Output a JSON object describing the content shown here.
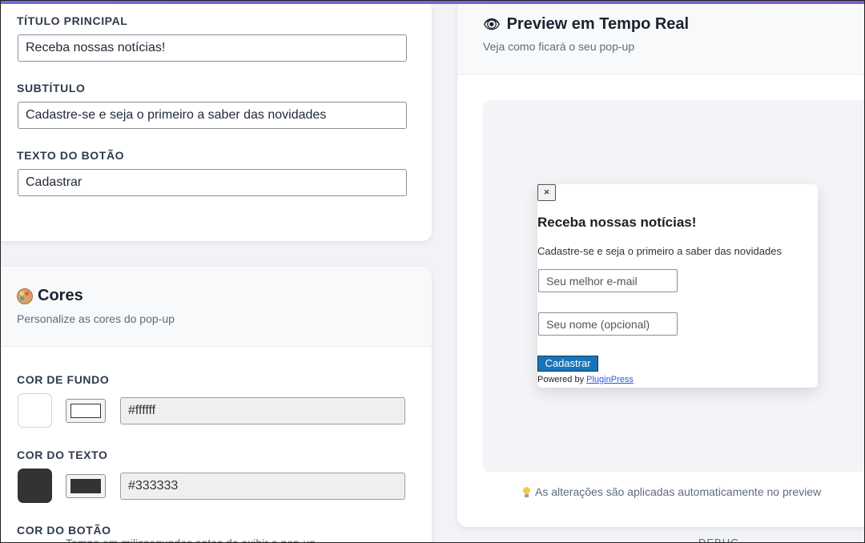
{
  "texts_section": {
    "title_label": "TÍTULO PRINCIPAL",
    "title_value": "Receba nossas notícias!",
    "subtitle_label": "SUBTÍTULO",
    "subtitle_value": "Cadastre-se e seja o primeiro a saber das novidades",
    "button_label": "TEXTO DO BOTÃO",
    "button_value": "Cadastrar"
  },
  "colors_section": {
    "icon": "palette-icon",
    "title": "Cores",
    "subtitle": "Personalize as cores do pop-up",
    "background": {
      "label": "COR DE FUNDO",
      "value": "#ffffff",
      "color": "#ffffff"
    },
    "text": {
      "label": "COR DO TEXTO",
      "value": "#333333",
      "color": "#333333"
    },
    "button": {
      "label": "COR DO BOTÃO"
    },
    "cut_off_text": "Tempo em milissegundos antes de exibir o pop-up"
  },
  "preview": {
    "icon": "eye-icon",
    "title": "Preview em Tempo Real",
    "subtitle": "Veja como ficará o seu pop-up",
    "popup": {
      "close_symbol": "×",
      "title": "Receba nossas notícias!",
      "subtitle": "Cadastre-se e seja o primeiro a saber das novidades",
      "email_placeholder": "Seu melhor e-mail",
      "name_placeholder": "Seu nome (opcional)",
      "button": "Cadastrar",
      "powered_prefix": "Powered by",
      "powered_link": "PluginPress",
      "button_color": "#1a73b6"
    },
    "hint_icon": "lightbulb-icon",
    "hint": "As alterações são aplicadas automaticamente no preview",
    "cut_off_text": "DEBUG"
  },
  "accent_gradient": [
    "#6f6bd8",
    "#7b5fc9"
  ]
}
